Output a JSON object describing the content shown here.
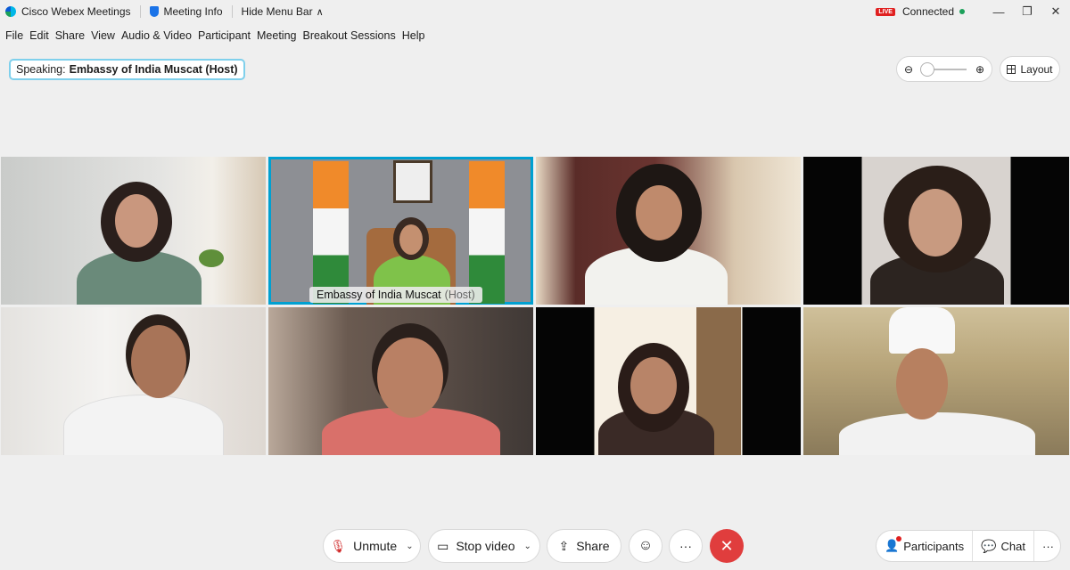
{
  "titlebar": {
    "app_name": "Cisco Webex Meetings",
    "meeting_info": "Meeting Info",
    "hide_menu_bar": "Hide Menu Bar",
    "live_badge": "LIVE",
    "status": "Connected",
    "status_color": "#1ba05a"
  },
  "menu": [
    "File",
    "Edit",
    "Share",
    "View",
    "Audio & Video",
    "Participant",
    "Meeting",
    "Breakout Sessions",
    "Help"
  ],
  "speaking": {
    "prefix": "Speaking:",
    "name": "Embassy of India Muscat (Host)"
  },
  "zoom": {
    "minus": "⊖",
    "plus": "⊕",
    "level": 0
  },
  "layout_label": "Layout",
  "videos": [
    {
      "label": "",
      "active": false
    },
    {
      "label": "Embassy of India Muscat",
      "role": "(Host)",
      "active": true
    },
    {
      "label": "",
      "active": false
    },
    {
      "label": "",
      "active": false
    },
    {
      "label": "",
      "active": false
    },
    {
      "label": "",
      "active": false
    },
    {
      "label": "",
      "active": false
    },
    {
      "label": "",
      "active": false
    }
  ],
  "controls": {
    "unmute": "Unmute",
    "stop_video": "Stop video",
    "share": "Share",
    "more": "···",
    "end": "✕"
  },
  "right_controls": {
    "participants": "Participants",
    "chat": "Chat",
    "more": "···"
  },
  "colors": {
    "accent": "#00a0d1",
    "end_call": "#e03d3d",
    "live": "#e02020"
  }
}
